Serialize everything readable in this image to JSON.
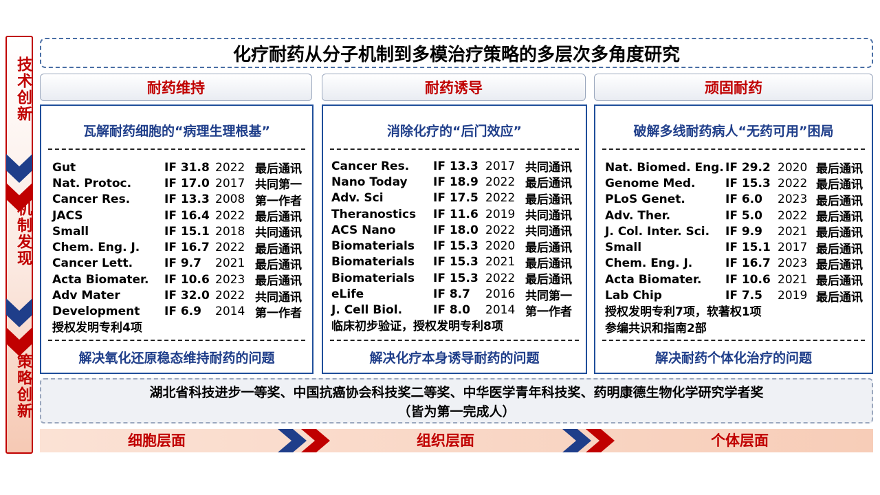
{
  "sidebar": {
    "labels": [
      "技术创新",
      "机制发现",
      "策略创新"
    ]
  },
  "header": {
    "title": "化疗耐药从分子机制到多模治疗策略的多层次多角度研究"
  },
  "categories": [
    "耐药维持",
    "耐药诱导",
    "顽固耐药"
  ],
  "panels": [
    {
      "title": "瓦解耐药细胞的“病理生理根基”",
      "rows": [
        {
          "journal": "Gut",
          "if": "IF 31.8",
          "year": "2022",
          "role": "最后通讯"
        },
        {
          "journal": "Nat. Protoc.",
          "if": "IF 17.0",
          "year": "2017",
          "role": "共同第一"
        },
        {
          "journal": "Cancer Res.",
          "if": "IF 13.3",
          "year": "2008",
          "role": "第一作者"
        },
        {
          "journal": "JACS",
          "if": "IF 16.4",
          "year": "2022",
          "role": "最后通讯"
        },
        {
          "journal": "Small",
          "if": "IF 15.1",
          "year": "2018",
          "role": "共同通讯"
        },
        {
          "journal": "Chem. Eng. J.",
          "if": "IF 16.7",
          "year": "2022",
          "role": "最后通讯"
        },
        {
          "journal": "Cancer Lett.",
          "if": "IF 9.7",
          "year": "2021",
          "role": "最后通讯"
        },
        {
          "journal": "Acta Biomater.",
          "if": "IF 10.6",
          "year": "2023",
          "role": "最后通讯"
        },
        {
          "journal": "Adv Mater",
          "if": "IF 32.0",
          "year": "2022",
          "role": "共同通讯"
        },
        {
          "journal": "Development",
          "if": "IF 6.9",
          "year": "2014",
          "role": "第一作者"
        }
      ],
      "notes": [
        "授权发明专利4项"
      ],
      "footer": "解决氧化还原稳态维持耐药的问题"
    },
    {
      "title": "消除化疗的“后门效应”",
      "rows": [
        {
          "journal": "Cancer Res.",
          "if": "IF 13.3",
          "year": "2017",
          "role": "共同通讯"
        },
        {
          "journal": "Nano Today",
          "if": "IF 18.9",
          "year": "2022",
          "role": "最后通讯"
        },
        {
          "journal": "Adv. Sci",
          "if": "IF 17.5",
          "year": "2022",
          "role": "最后通讯"
        },
        {
          "journal": "Theranostics",
          "if": "IF 11.6",
          "year": "2019",
          "role": "共同通讯"
        },
        {
          "journal": "ACS Nano",
          "if": "IF 18.0",
          "year": "2022",
          "role": "共同通讯"
        },
        {
          "journal": "Biomaterials",
          "if": "IF 15.3",
          "year": "2020",
          "role": "最后通讯"
        },
        {
          "journal": "Biomaterials",
          "if": "IF 15.3",
          "year": "2021",
          "role": "最后通讯"
        },
        {
          "journal": "Biomaterials",
          "if": "IF 15.3",
          "year": "2022",
          "role": "最后通讯"
        },
        {
          "journal": "eLife",
          "if": "IF 8.7",
          "year": "2016",
          "role": "共同第一"
        },
        {
          "journal": "J. Cell Biol.",
          "if": "IF 8.0",
          "year": "2014",
          "role": "第一作者"
        }
      ],
      "notes": [
        "临床初步验证，授权发明专利8项"
      ],
      "footer": "解决化疗本身诱导耐药的问题"
    },
    {
      "title": "破解多线耐药病人“无药可用”困局",
      "rows": [
        {
          "journal": "Nat. Biomed. Eng.",
          "if": "IF 29.2",
          "year": "2020",
          "role": "最后通讯"
        },
        {
          "journal": "Genome Med.",
          "if": "IF 15.3",
          "year": "2022",
          "role": "最后通讯"
        },
        {
          "journal": "PLoS Genet.",
          "if": "IF 6.0",
          "year": "2023",
          "role": "最后通讯"
        },
        {
          "journal": "Adv. Ther.",
          "if": "IF 5.0",
          "year": "2022",
          "role": "最后通讯"
        },
        {
          "journal": "J. Col. Inter. Sci.",
          "if": "IF 9.9",
          "year": "2021",
          "role": "最后通讯"
        },
        {
          "journal": "Small",
          "if": "IF 15.1",
          "year": "2017",
          "role": "最后通讯"
        },
        {
          "journal": "Chem. Eng. J.",
          "if": "IF 16.7",
          "year": "2023",
          "role": "最后通讯"
        },
        {
          "journal": "Acta Biomater.",
          "if": "IF 10.6",
          "year": "2021",
          "role": "最后通讯"
        },
        {
          "journal": "Lab Chip",
          "if": "IF 7.5",
          "year": "2019",
          "role": "最后通讯"
        }
      ],
      "notes": [
        "授权发明专利7项，软著权1项",
        "参编共识和指南2部"
      ],
      "footer": "解决耐药个体化治疗的问题"
    }
  ],
  "awards": {
    "line1": "湖北省科技进步一等奖、中国抗癌协会科技奖二等奖、中华医学青年科技奖、药明康德生物化学研究学者奖",
    "line2": "（皆为第一完成人）"
  },
  "flow": [
    "细胞层面",
    "组织层面",
    "个体层面"
  ],
  "colors": {
    "red": "#c00000",
    "navy": "#1f3e8a",
    "panel_border": "#1f4e9a"
  }
}
